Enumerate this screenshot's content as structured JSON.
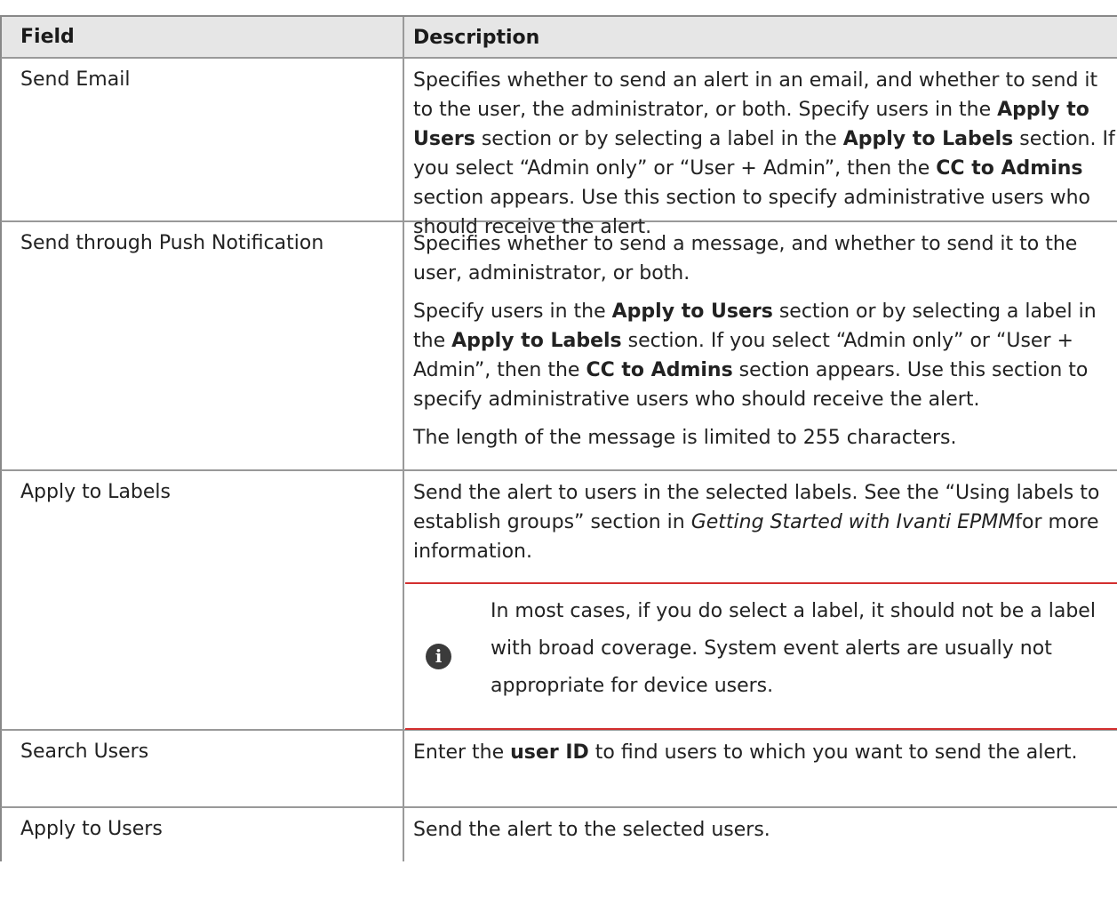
{
  "table": {
    "header": {
      "field": "Field",
      "description": "Description"
    },
    "rows": [
      {
        "field": "Send Email",
        "p1": {
          "a": "Specifies whether to send an alert in an email, and whether to send it to the user, the administrator, or both. Specify users in the ",
          "b1": "Apply to Users",
          "c": " section or by selecting a label in the ",
          "b2": "Apply to Labels",
          "d": " section. If you select “Admin only” or “User + Admin”, then the ",
          "b3": "CC to Admins",
          "e": " section appears. Use this section to specify administrative users who should receive the alert."
        }
      },
      {
        "field": "Send through Push Notification",
        "p1": "Specifies whether to send a message, and whether to send it to the user, administrator, or both.",
        "p2": {
          "a": "Specify users in the ",
          "b1": "Apply to Users",
          "c": " section or by selecting a label in the ",
          "b2": "Apply to Labels",
          "d": " section. If you select “Admin only” or “User + Admin”, then the ",
          "b3": "CC to Admins",
          "e": " section appears. Use this section to specify administrative users who should receive the alert."
        },
        "p3": "The length of the message is limited to 255 characters."
      },
      {
        "field": "Apply to Labels",
        "p1": {
          "a": "Send the alert to users in the selected labels. See the “Using labels to establish groups” section in ",
          "i1": "Getting Started with Ivanti EPMM",
          "c": "for more information."
        },
        "note": {
          "icon": "info-icon",
          "icon_glyph": "i",
          "text": "In most cases, if you do select a label, it should not be a label with broad coverage. System event alerts are usually not appropriate for device users."
        }
      },
      {
        "field": "Search Users",
        "p1": {
          "a": "Enter the ",
          "b1": "user ID",
          "c": " to find users to which you want to send the alert."
        }
      },
      {
        "field": "Apply to Users",
        "p1": "Send the alert to the selected users."
      }
    ]
  },
  "colors": {
    "header_bg": "#e6e6e6",
    "note_rule": "#d32f2f",
    "icon_bg": "#3b3b3b"
  }
}
